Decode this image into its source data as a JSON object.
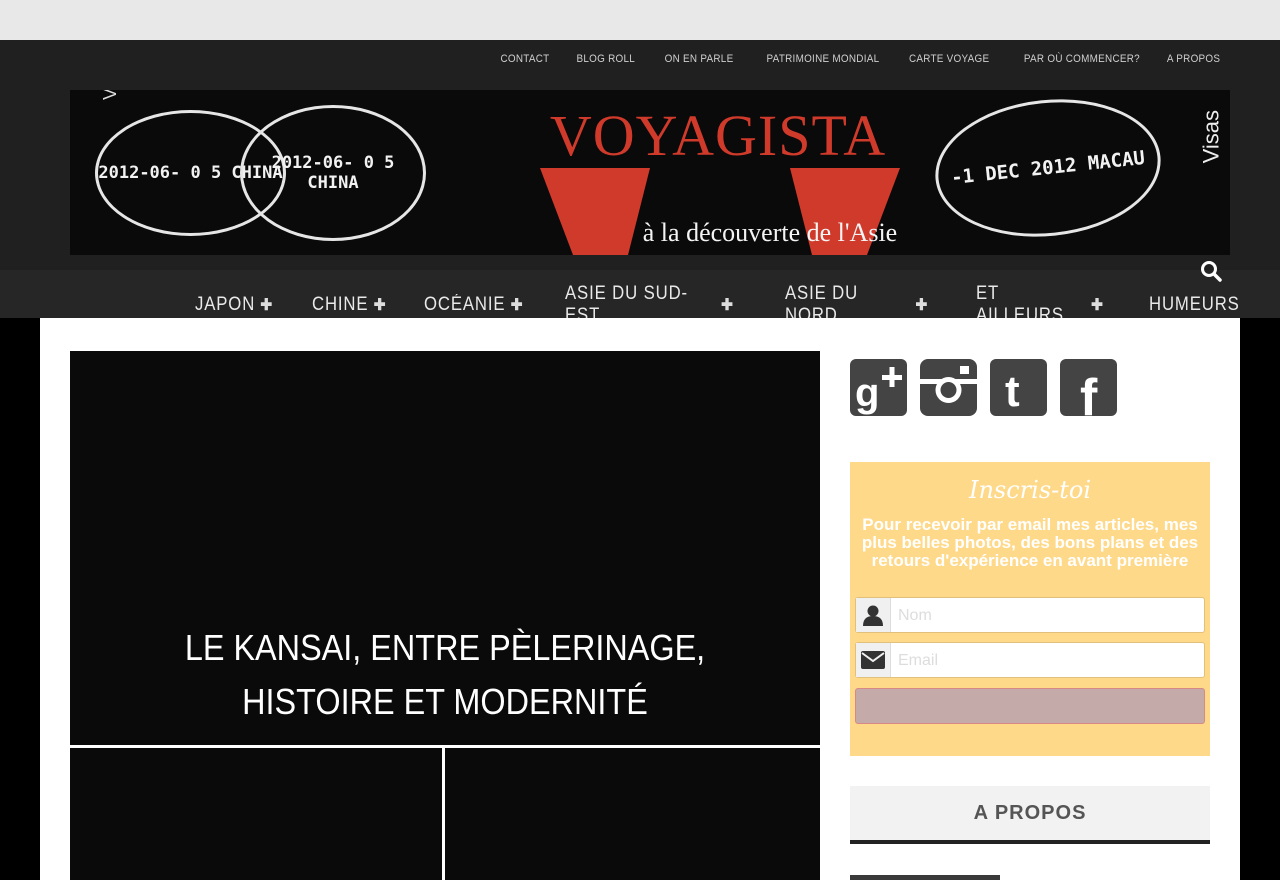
{
  "top_nav": {
    "items": [
      "CONTACT",
      "BLOG ROLL",
      "ON EN PARLE",
      "PATRIMOINE MONDIAL",
      "CARTE VOYAGE",
      "PAR OÙ COMMENCER?",
      "A PROPOS"
    ]
  },
  "banner": {
    "brand": "VOYAGISTA",
    "tagline": "à la découverte de l'Asie",
    "side_text": "Visas",
    "stamps": [
      "2012-06- 0 5 CHINA",
      "2012-06- 0 5 CHINA",
      "-1 DEC 2012 MACAU"
    ]
  },
  "main_nav": {
    "items": [
      {
        "label": "JAPON",
        "has_sub": true
      },
      {
        "label": "CHINE",
        "has_sub": true
      },
      {
        "label": "OCÉANIE",
        "has_sub": true
      },
      {
        "label": "ASIE DU SUD-EST",
        "has_sub": true
      },
      {
        "label": "ASIE DU NORD",
        "has_sub": true
      },
      {
        "label": "ET AILLEURS",
        "has_sub": true
      },
      {
        "label": "HUMEURS",
        "has_sub": false
      }
    ],
    "search_icon": "search-icon"
  },
  "hero": {
    "title": "LE KANSAI, ENTRE PÈLERINAGE, HISTOIRE ET MODERNITÉ"
  },
  "social": [
    "google-plus-icon",
    "instagram-icon",
    "tumblr-icon",
    "facebook-icon"
  ],
  "newsletter": {
    "title": "Inscris-toi",
    "text": "Pour recevoir par email mes articles, mes plus belles photos, des bons plans et des retours d'expérience en avant première",
    "name_placeholder": "Nom",
    "email_placeholder": "Email",
    "colors": {
      "background": "#ffd98a",
      "button": "#c4aaa8"
    }
  },
  "sidebar": {
    "apropos_title": "A PROPOS"
  },
  "colors": {
    "accent": "#d03a2b",
    "nav_bg": "#262626"
  }
}
